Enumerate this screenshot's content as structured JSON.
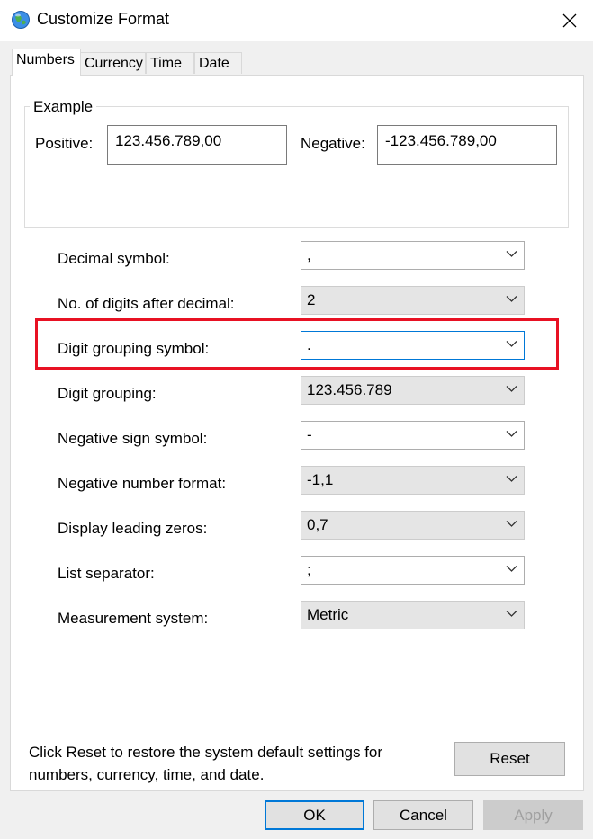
{
  "window": {
    "title": "Customize Format"
  },
  "tabs": [
    {
      "label": "Numbers",
      "active": true
    },
    {
      "label": "Currency",
      "active": false
    },
    {
      "label": "Time",
      "active": false
    },
    {
      "label": "Date",
      "active": false
    }
  ],
  "example": {
    "legend": "Example",
    "positive_label": "Positive:",
    "positive_value": "123.456.789,00",
    "negative_label": "Negative:",
    "negative_value": "-123.456.789,00"
  },
  "settings": [
    {
      "label": "Decimal symbol:",
      "value": ",",
      "enabled": true
    },
    {
      "label": "No. of digits after decimal:",
      "value": "2",
      "enabled": false
    },
    {
      "label": "Digit grouping symbol:",
      "value": ".",
      "enabled": true,
      "focused": true
    },
    {
      "label": "Digit grouping:",
      "value": "123.456.789",
      "enabled": false
    },
    {
      "label": "Negative sign symbol:",
      "value": "-",
      "enabled": true
    },
    {
      "label": "Negative number format:",
      "value": "-1,1",
      "enabled": false
    },
    {
      "label": "Display leading zeros:",
      "value": "0,7",
      "enabled": false
    },
    {
      "label": "List separator:",
      "value": ";",
      "enabled": true
    },
    {
      "label": "Measurement system:",
      "value": "Metric",
      "enabled": false
    }
  ],
  "footer": {
    "note": "Click Reset to restore the system default settings for numbers, currency, time, and date.",
    "reset_label": "Reset"
  },
  "buttons": {
    "ok": "OK",
    "cancel": "Cancel",
    "apply": "Apply"
  },
  "colors": {
    "highlight": "#e81123",
    "focus": "#0078d7"
  }
}
